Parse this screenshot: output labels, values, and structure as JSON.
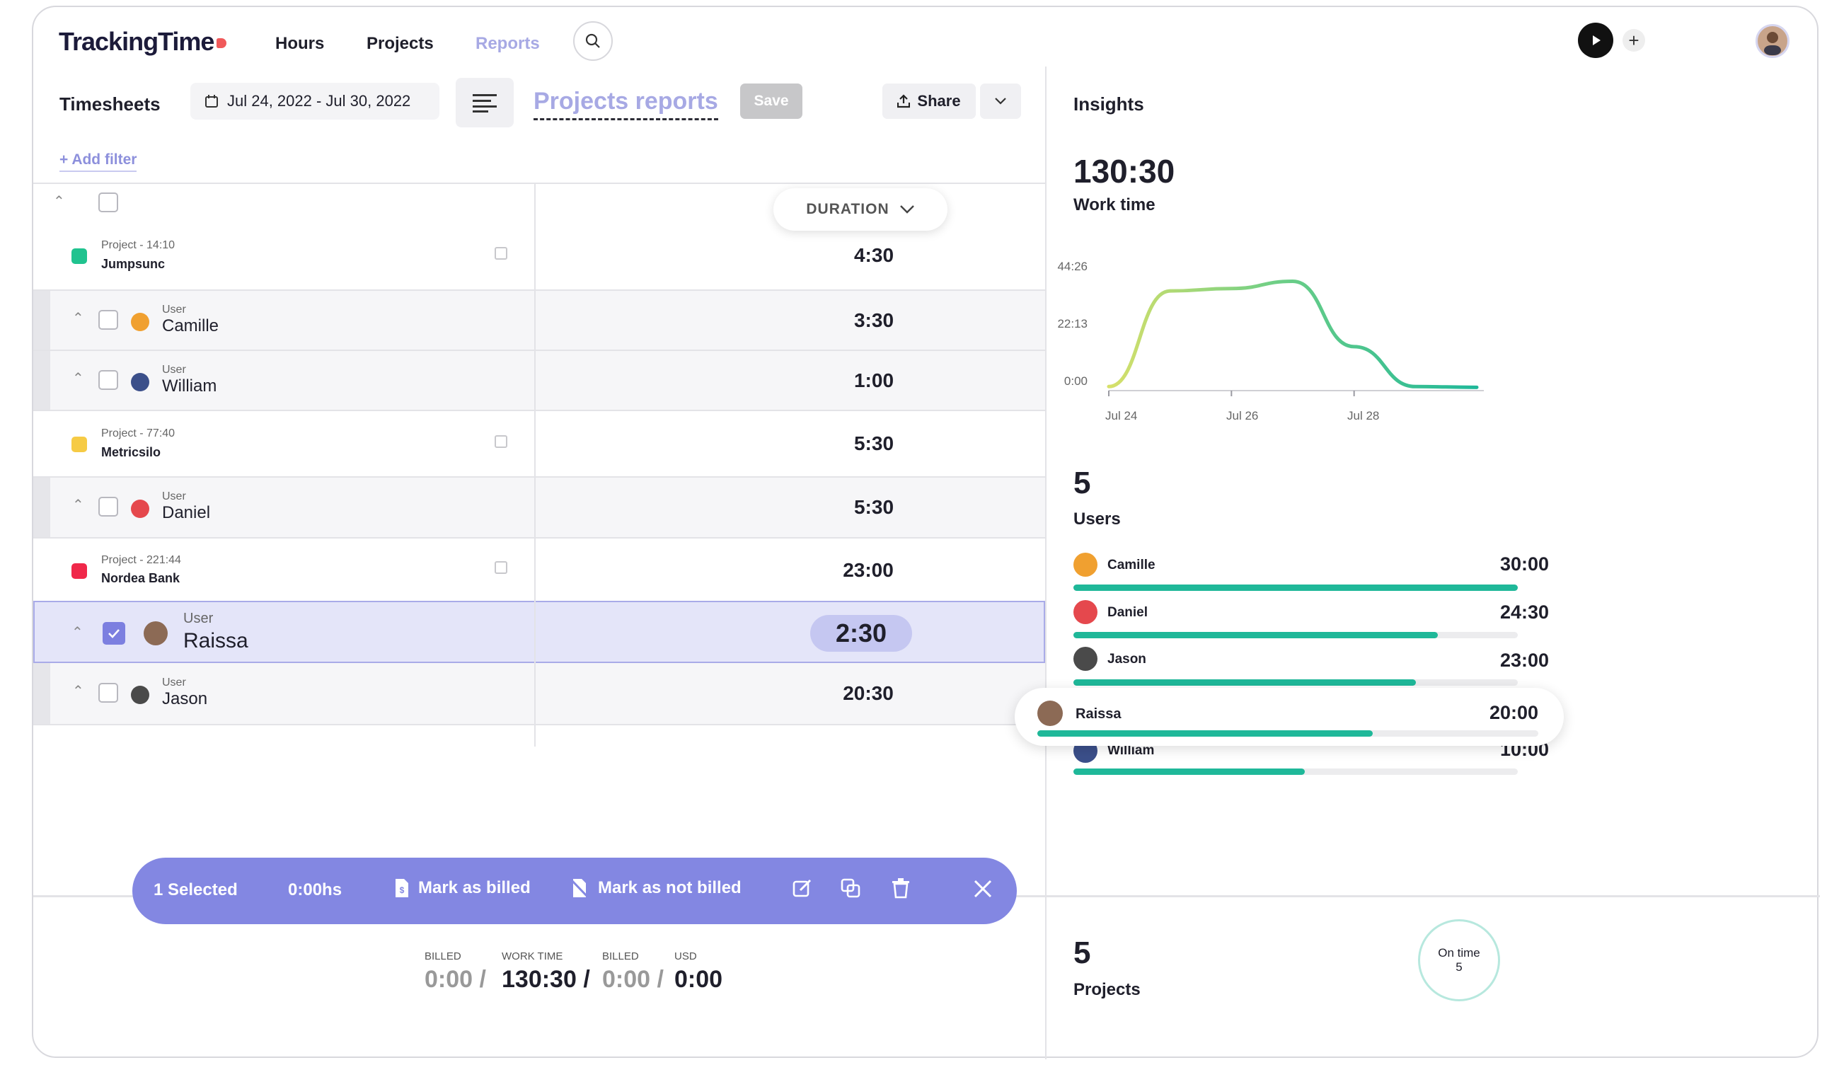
{
  "app": {
    "logo": "TrackingTime"
  },
  "nav": {
    "hours": "Hours",
    "projects": "Projects",
    "reports": "Reports"
  },
  "toolbar": {
    "section": "Timesheets",
    "date_range": "Jul 24, 2022 - Jul 30, 2022",
    "report_title": "Projects reports",
    "save": "Save",
    "share": "Share",
    "add_filter": "+ Add filter"
  },
  "table": {
    "duration_header": "DURATION",
    "rows": [
      {
        "kind": "project",
        "label": "Project - 14:10",
        "name": "Jumpsunc",
        "duration": "4:30",
        "color": "#20c38f"
      },
      {
        "kind": "user",
        "label": "User",
        "name": "Camille",
        "duration": "3:30"
      },
      {
        "kind": "user",
        "label": "User",
        "name": "William",
        "duration": "1:00"
      },
      {
        "kind": "project",
        "label": "Project - 77:40",
        "name": "Metricsilo",
        "duration": "5:30",
        "color": "#f6cb45"
      },
      {
        "kind": "user",
        "label": "User",
        "name": "Daniel",
        "duration": "5:30"
      },
      {
        "kind": "project",
        "label": "Project - 221:44",
        "name": "Nordea Bank",
        "duration": "23:00",
        "color": "#f0284a"
      },
      {
        "kind": "user",
        "label": "User",
        "name": "Raissa",
        "duration": "2:30",
        "selected": true
      },
      {
        "kind": "user",
        "label": "User",
        "name": "Jason",
        "duration": "20:30"
      }
    ]
  },
  "selection_bar": {
    "count": "1 Selected",
    "hours": "0:00hs",
    "mark_billed": "Mark as billed",
    "mark_not_billed": "Mark as not billed"
  },
  "totals": [
    {
      "label": "BILLED",
      "value": "0:00 /",
      "muted": true
    },
    {
      "label": "WORK TIME",
      "value": "130:30 /",
      "muted": false
    },
    {
      "label": "BILLED",
      "value": "0:00 /",
      "muted": true
    },
    {
      "label": "USD",
      "value": "0:00",
      "muted": false
    }
  ],
  "insights": {
    "title": "Insights",
    "work_time_value": "130:30",
    "work_time_label": "Work time",
    "users_count": "5",
    "users_label": "Users",
    "users": [
      {
        "name": "Camille",
        "time": "30:00",
        "fraction": 1.0
      },
      {
        "name": "Daniel",
        "time": "24:30",
        "fraction": 0.82
      },
      {
        "name": "Jason",
        "time": "23:00",
        "fraction": 0.77
      },
      {
        "name": "William",
        "time": "10:00",
        "fraction": 0.52
      }
    ],
    "highlight_user": {
      "name": "Raissa",
      "time": "20:00",
      "fraction": 0.67
    },
    "projects_count": "5",
    "projects_label": "Projects",
    "on_time_label": "On time",
    "on_time_value": "5",
    "accent": "#1fb899"
  },
  "chart_data": {
    "type": "line",
    "x": [
      "Jul 24",
      "Jul 25",
      "Jul 26",
      "Jul 27",
      "Jul 28",
      "Jul 29",
      "Jul 30"
    ],
    "series": [
      {
        "values": [
          0.5,
          40,
          41,
          44,
          17,
          0.5,
          0.2
        ]
      }
    ],
    "y_ticks": [
      "0:00",
      "22:13",
      "44:26"
    ],
    "x_ticks": [
      "Jul 24",
      "Jul 26",
      "Jul 28"
    ],
    "ylim": [
      0,
      44.43
    ]
  }
}
